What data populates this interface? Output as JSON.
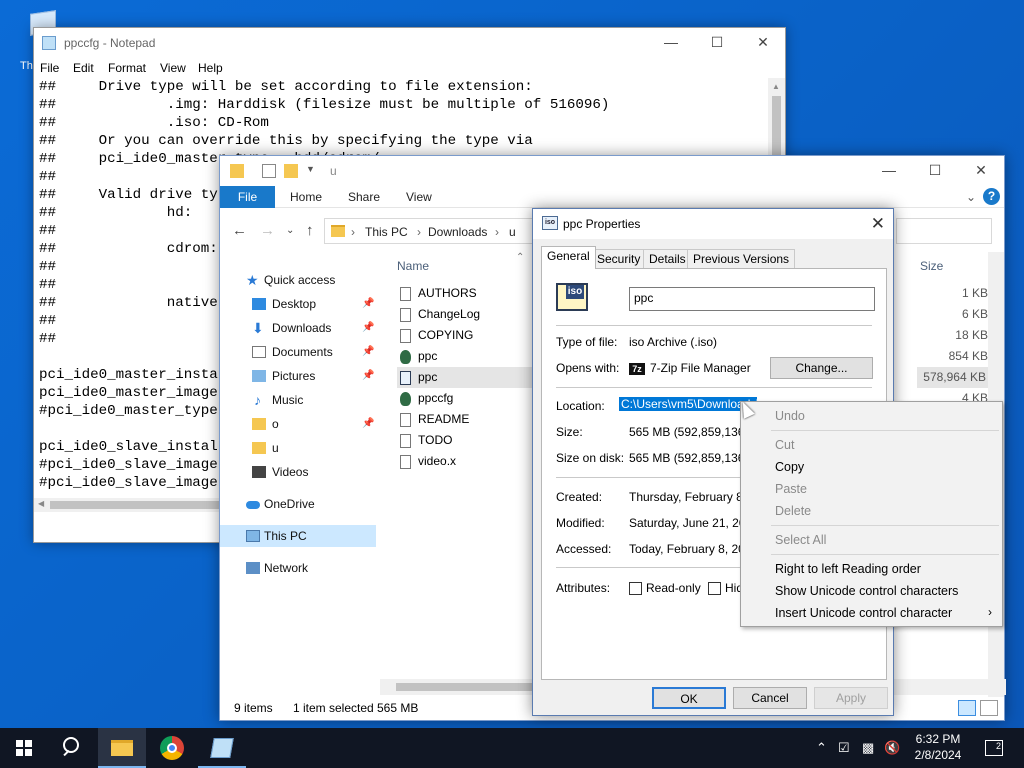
{
  "desktop": {
    "icon_label": "Th"
  },
  "notepad": {
    "title": "ppccfg - Notepad",
    "menu": [
      "File",
      "Edit",
      "Format",
      "View",
      "Help"
    ],
    "lines": [
      "##     Drive type will be set according to file extension:",
      "##             .img: Harddisk (filesize must be multiple of 516096)",
      "##             .iso: CD-Rom",
      "##     Or you can override this by specifying the type via",
      "##     pci_ide0_master_type = hdd/cdrom/...",
      "##",
      "##     Valid drive types:",
      "##             hd:",
      "##",
      "##             cdrom:",
      "##",
      "##",
      "##             native",
      "##",
      "##",
      "",
      "pci_ide0_master_installed = 1",
      "pci_ide0_master_image = ppc.iso",
      "#pci_ide0_master_type = cdrom",
      "",
      "pci_ide0_slave_installed = 1",
      "#pci_ide0_slave_image = ...",
      "#pci_ide0_slave_image = ..."
    ]
  },
  "explorer": {
    "title_path": "u",
    "ribbon": {
      "file": "File",
      "tabs": [
        "Home",
        "Share",
        "View"
      ]
    },
    "address": {
      "crumbs": [
        "This PC",
        "Downloads",
        "u"
      ]
    },
    "nav": [
      {
        "label": "Quick access",
        "icon": "star-icon"
      },
      {
        "label": "Desktop",
        "icon": "desktop-icon",
        "pinned": true
      },
      {
        "label": "Downloads",
        "icon": "download-icon",
        "pinned": true
      },
      {
        "label": "Documents",
        "icon": "documents-icon",
        "pinned": true
      },
      {
        "label": "Pictures",
        "icon": "pictures-icon",
        "pinned": true
      },
      {
        "label": "Music",
        "icon": "music-icon"
      },
      {
        "label": "o",
        "icon": "folder-icon",
        "pinned": true
      },
      {
        "label": "u",
        "icon": "folder-icon"
      },
      {
        "label": "Videos",
        "icon": "videos-icon"
      },
      {
        "label": "OneDrive",
        "icon": "cloud-icon"
      },
      {
        "label": "This PC",
        "icon": "computer-icon"
      },
      {
        "label": "Network",
        "icon": "network-icon"
      }
    ],
    "columns": {
      "name": "Name",
      "size": "Size"
    },
    "files": [
      "AUTHORS",
      "ChangeLog",
      "COPYING",
      "ppc",
      "ppc",
      "ppccfg",
      "README",
      "TODO",
      "video.x"
    ],
    "sizes": [
      "1 KB",
      "6 KB",
      "18 KB",
      "854 KB",
      "578,964 KB",
      "4 KB"
    ],
    "status": {
      "items": "9 items",
      "selected": "1 item selected",
      "size": "565 MB"
    }
  },
  "properties": {
    "title": "ppc Properties",
    "tabs": [
      "General",
      "Security",
      "Details",
      "Previous Versions"
    ],
    "name_value": "ppc",
    "type_label": "Type of file:",
    "type_value": "iso Archive (.iso)",
    "opens_label": "Opens with:",
    "opens_value": "7-Zip File Manager",
    "change_btn": "Change...",
    "location_label": "Location:",
    "location_value": "C:\\Users\\vm5\\Downloads\\u",
    "size_label": "Size:",
    "size_value": "565 MB (592,859,136 by",
    "size_disk_label": "Size on disk:",
    "size_disk_value": "565 MB (592,859,136 by",
    "created_label": "Created:",
    "created_value": "Thursday, February 8, 2",
    "modified_label": "Modified:",
    "modified_value": "Saturday, June 21, 2008",
    "accessed_label": "Accessed:",
    "accessed_value": "Today, February 8, 2024",
    "attributes_label": "Attributes:",
    "readonly": "Read-only",
    "hidden": "Hid",
    "ok": "OK",
    "cancel": "Cancel",
    "apply": "Apply"
  },
  "context_menu": {
    "undo": "Undo",
    "cut": "Cut",
    "copy": "Copy",
    "paste": "Paste",
    "delete": "Delete",
    "select_all": "Select All",
    "rtl": "Right to left Reading order",
    "show_unicode": "Show Unicode control characters",
    "insert_unicode": "Insert Unicode control character"
  },
  "taskbar": {
    "time": "6:32 PM",
    "date": "2/8/2024",
    "notifications": "2"
  }
}
